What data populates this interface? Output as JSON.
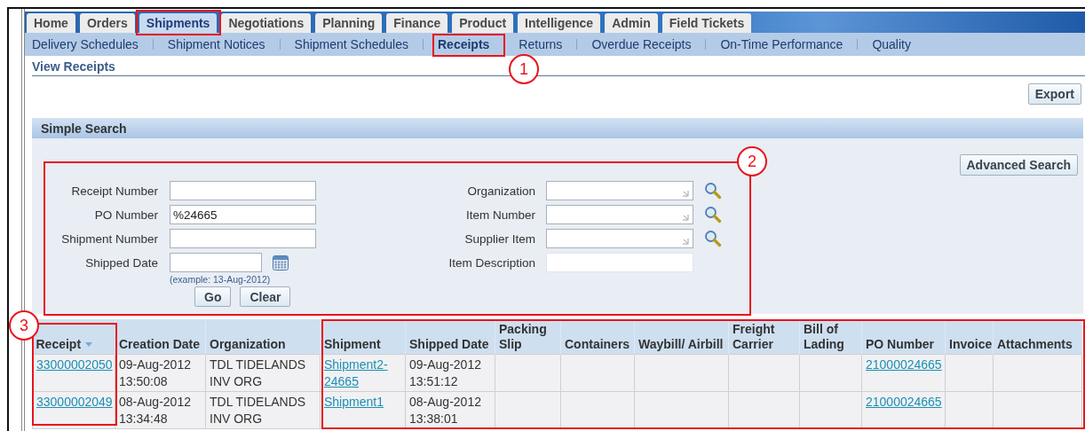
{
  "tabs": [
    {
      "label": "Home",
      "selected": false
    },
    {
      "label": "Orders",
      "selected": false
    },
    {
      "label": "Shipments",
      "selected": true
    },
    {
      "label": "Negotiations",
      "selected": false
    },
    {
      "label": "Planning",
      "selected": false
    },
    {
      "label": "Finance",
      "selected": false
    },
    {
      "label": "Product",
      "selected": false
    },
    {
      "label": "Intelligence",
      "selected": false
    },
    {
      "label": "Admin",
      "selected": false
    },
    {
      "label": "Field Tickets",
      "selected": false
    }
  ],
  "subtabs": [
    {
      "label": "Delivery Schedules",
      "selected": false
    },
    {
      "label": "Shipment Notices",
      "selected": false
    },
    {
      "label": "Shipment Schedules",
      "selected": false
    },
    {
      "label": "Receipts",
      "selected": true
    },
    {
      "label": "Returns",
      "selected": false
    },
    {
      "label": "Overdue Receipts",
      "selected": false
    },
    {
      "label": "On-Time Performance",
      "selected": false
    },
    {
      "label": "Quality",
      "selected": false
    }
  ],
  "page_title": "View Receipts",
  "export_button": "Export",
  "search": {
    "title": "Simple Search",
    "advanced_button": "Advanced Search",
    "left_fields": [
      {
        "label": "Receipt Number",
        "kind": "text"
      },
      {
        "label": "PO Number",
        "kind": "text",
        "value": "%24665"
      },
      {
        "label": "Shipment Number",
        "kind": "text"
      },
      {
        "label": "Shipped Date",
        "kind": "date",
        "hint": "(example: 13-Aug-2012)"
      }
    ],
    "right_fields": [
      {
        "label": "Organization",
        "kind": "lov"
      },
      {
        "label": "Item Number",
        "kind": "lov"
      },
      {
        "label": "Supplier Item",
        "kind": "lov"
      },
      {
        "label": "Item Description",
        "kind": "text"
      }
    ],
    "buttons": [
      "Go",
      "Clear"
    ]
  },
  "table": {
    "columns": [
      {
        "label": "Receipt",
        "sorted": true
      },
      {
        "label": "Creation Date",
        "sorted": false
      },
      {
        "label": "Organization",
        "sorted": false
      },
      {
        "label": "Shipment",
        "sorted": false
      },
      {
        "label": "Shipped Date",
        "sorted": false
      },
      {
        "label": "Packing Slip",
        "sorted": false
      },
      {
        "label": "Containers",
        "sorted": false
      },
      {
        "label": "Waybill/ Airbill",
        "sorted": false
      },
      {
        "label": "Freight Carrier",
        "sorted": false
      },
      {
        "label": "Bill of Lading",
        "sorted": false
      },
      {
        "label": "PO Number",
        "sorted": false
      },
      {
        "label": "Invoice",
        "sorted": false
      },
      {
        "label": "Attachments",
        "sorted": false
      }
    ],
    "rows": [
      {
        "cells": [
          {
            "text": "33000002050",
            "link": true
          },
          {
            "text": "09-Aug-2012 13:50:08",
            "link": false
          },
          {
            "text": "TDL TIDELANDS INV ORG",
            "link": false
          },
          {
            "text": "Shipment2-24665",
            "link": true
          },
          {
            "text": "09-Aug-2012 13:51:12",
            "link": false
          },
          null,
          null,
          null,
          null,
          null,
          {
            "text": "21000024665",
            "link": true
          },
          null,
          null
        ]
      },
      {
        "cells": [
          {
            "text": "33000002049",
            "link": true
          },
          {
            "text": "08-Aug-2012 13:34:48",
            "link": false
          },
          {
            "text": "TDL TIDELANDS INV ORG",
            "link": false
          },
          {
            "text": "Shipment1",
            "link": true
          },
          {
            "text": "08-Aug-2012 13:38:01",
            "link": false
          },
          null,
          null,
          null,
          null,
          null,
          {
            "text": "21000024665",
            "link": true
          },
          null,
          null
        ]
      }
    ]
  },
  "callouts": [
    {
      "number": "1"
    },
    {
      "number": "2"
    },
    {
      "number": "3"
    }
  ]
}
